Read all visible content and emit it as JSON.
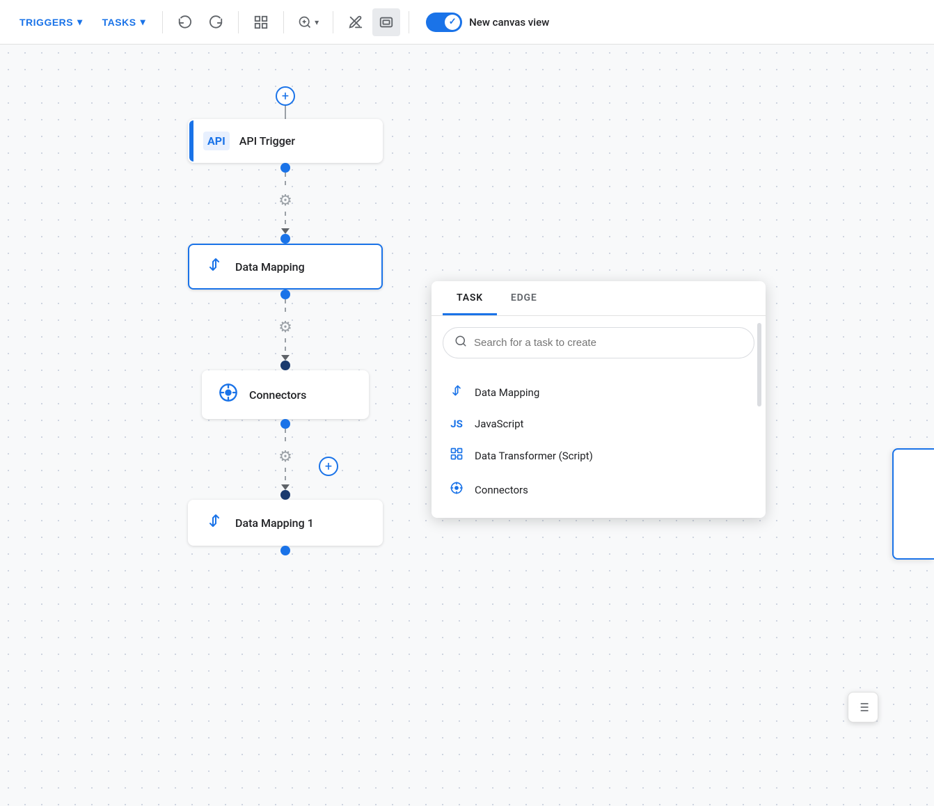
{
  "toolbar": {
    "triggers_label": "TRIGGERS",
    "tasks_label": "TASKS",
    "new_canvas_label": "New canvas view",
    "toggle_state": "on"
  },
  "canvas": {
    "nodes": [
      {
        "id": "api-trigger",
        "label": "API Trigger",
        "type": "api",
        "selected": false
      },
      {
        "id": "data-mapping",
        "label": "Data Mapping",
        "type": "data-mapping",
        "selected": true
      },
      {
        "id": "connectors",
        "label": "Connectors",
        "type": "connectors",
        "selected": false
      },
      {
        "id": "data-mapping-1",
        "label": "Data Mapping 1",
        "type": "data-mapping",
        "selected": false
      }
    ]
  },
  "popup": {
    "tabs": [
      {
        "id": "task",
        "label": "TASK",
        "active": true
      },
      {
        "id": "edge",
        "label": "EDGE",
        "active": false
      }
    ],
    "search_placeholder": "Search for a task to create",
    "items": [
      {
        "id": "data-mapping",
        "label": "Data Mapping",
        "icon": "data-mapping"
      },
      {
        "id": "javascript",
        "label": "JavaScript",
        "icon": "js"
      },
      {
        "id": "data-transformer",
        "label": "Data Transformer (Script)",
        "icon": "data-transformer"
      },
      {
        "id": "connectors",
        "label": "Connectors",
        "icon": "connectors"
      }
    ]
  }
}
